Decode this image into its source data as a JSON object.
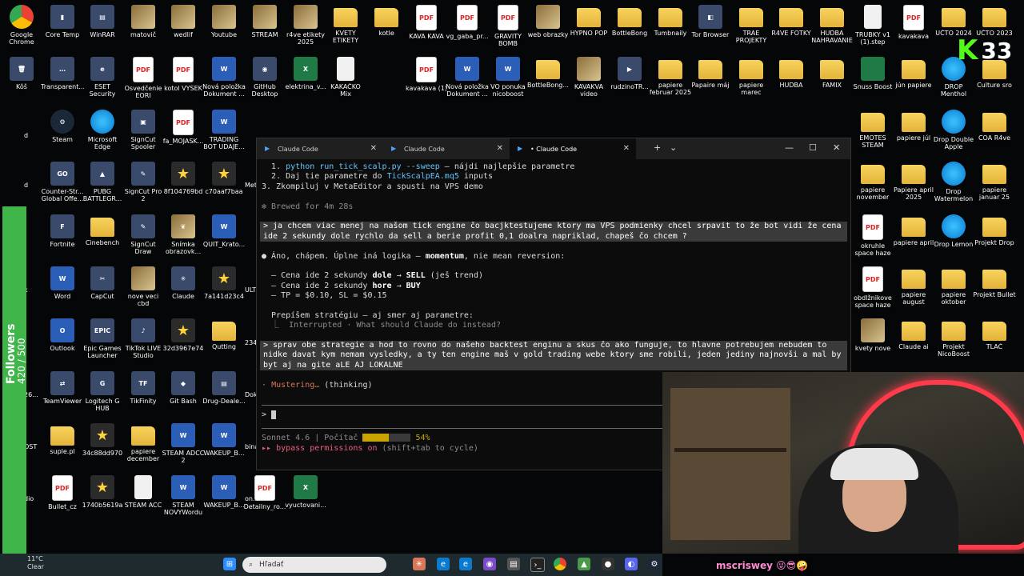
{
  "desktop": {
    "icons": [
      {
        "label": "Google Chrome",
        "kind": "chrome",
        "glyph": ""
      },
      {
        "label": "Core Temp",
        "kind": "app",
        "glyph": "▮"
      },
      {
        "label": "WinRAR",
        "kind": "app",
        "glyph": "▤"
      },
      {
        "label": "matovič",
        "kind": "img",
        "glyph": ""
      },
      {
        "label": "wedlif",
        "kind": "img",
        "glyph": ""
      },
      {
        "label": "Youtube",
        "kind": "img",
        "glyph": ""
      },
      {
        "label": "STREAM",
        "kind": "img",
        "glyph": ""
      },
      {
        "label": "r4ve etikety 2025",
        "kind": "img",
        "glyph": ""
      },
      {
        "label": "KVETY ETIKETY",
        "kind": "folder",
        "glyph": ""
      },
      {
        "label": "kotle",
        "kind": "folder",
        "glyph": ""
      },
      {
        "label": "KAVA KAVA",
        "kind": "pdf",
        "glyph": "PDF"
      },
      {
        "label": "vg_gaba_pr...",
        "kind": "pdf",
        "glyph": "PDF"
      },
      {
        "label": "GRAVITY BOMB",
        "kind": "pdf",
        "glyph": "PDF"
      },
      {
        "label": "web obrazky",
        "kind": "img",
        "glyph": ""
      },
      {
        "label": "HYPNO POP",
        "kind": "folder",
        "glyph": ""
      },
      {
        "label": "BottleBong",
        "kind": "folder",
        "glyph": ""
      },
      {
        "label": "Tumbnaily",
        "kind": "folder",
        "glyph": ""
      },
      {
        "label": "Tor Browser",
        "kind": "app",
        "glyph": "◧"
      },
      {
        "label": "TRAE PROJEKTY",
        "kind": "folder",
        "glyph": ""
      },
      {
        "label": "R4VE FOTKY",
        "kind": "folder",
        "glyph": ""
      },
      {
        "label": "HUDBA NAHRAVANIE",
        "kind": "folder",
        "glyph": ""
      },
      {
        "label": "TRUBKY v1 (1).step",
        "kind": "file",
        "glyph": ""
      },
      {
        "label": "kavakava",
        "kind": "pdf",
        "glyph": "PDF"
      },
      {
        "label": "UČTO 2024",
        "kind": "folder",
        "glyph": ""
      },
      {
        "label": "UČTO 2023",
        "kind": "folder",
        "glyph": ""
      },
      {
        "label": "Kôš",
        "kind": "app",
        "glyph": "🗑"
      },
      {
        "label": "Transparent...",
        "kind": "app",
        "glyph": "…"
      },
      {
        "label": "ESET Security",
        "kind": "app",
        "glyph": "e"
      },
      {
        "label": "Osvedčenie EORI",
        "kind": "pdf",
        "glyph": "PDF"
      },
      {
        "label": "kotol VYSEK",
        "kind": "pdf",
        "glyph": "PDF"
      },
      {
        "label": "Nová položka Dokument ...",
        "kind": "word",
        "glyph": "W"
      },
      {
        "label": "GitHub Desktop",
        "kind": "app",
        "glyph": "◉"
      },
      {
        "label": "elektrina_v...",
        "kind": "excel",
        "glyph": "X"
      },
      {
        "label": "KAKAČKO Mix",
        "kind": "file",
        "glyph": ""
      },
      {
        "label": "kavakava (1)",
        "kind": "pdf",
        "glyph": "PDF"
      },
      {
        "label": "Nová položka Dokument ...",
        "kind": "word",
        "glyph": "W"
      },
      {
        "label": "VO ponuka nicoboost",
        "kind": "word",
        "glyph": "W"
      },
      {
        "label": "BottleBong...",
        "kind": "folder",
        "glyph": ""
      },
      {
        "label": "KAVAKVA video",
        "kind": "img",
        "glyph": ""
      },
      {
        "label": "rudzinoTR...",
        "kind": "app",
        "glyph": "▶"
      },
      {
        "label": "papiere februar 2025",
        "kind": "folder",
        "glyph": ""
      },
      {
        "label": "Papaire máj",
        "kind": "folder",
        "glyph": ""
      },
      {
        "label": "papiere marec",
        "kind": "folder",
        "glyph": ""
      },
      {
        "label": "HUDBA",
        "kind": "folder",
        "glyph": ""
      },
      {
        "label": "FAMIX",
        "kind": "folder",
        "glyph": ""
      },
      {
        "label": "Snuss Boost",
        "kind": "excel",
        "glyph": ""
      },
      {
        "label": "jún papiere",
        "kind": "folder",
        "glyph": ""
      },
      {
        "label": "DROP Menthol",
        "kind": "edge",
        "glyph": ""
      },
      {
        "label": "Culture sro",
        "kind": "folder",
        "glyph": ""
      },
      {
        "label": "Steam",
        "kind": "steam",
        "glyph": "⚙"
      },
      {
        "label": "Microsoft Edge",
        "kind": "edge",
        "glyph": ""
      },
      {
        "label": "SignCut Spooler",
        "kind": "app",
        "glyph": "▣"
      },
      {
        "label": "fa_MOJASK...",
        "kind": "pdf",
        "glyph": "PDF"
      },
      {
        "label": "TRADING BOT UDAJE...",
        "kind": "word",
        "glyph": "W"
      },
      {
        "label": "EMOTES STEAM",
        "kind": "folder",
        "glyph": ""
      },
      {
        "label": "papiere júl",
        "kind": "folder",
        "glyph": ""
      },
      {
        "label": "Drop Double Apple",
        "kind": "edge",
        "glyph": ""
      },
      {
        "label": "COA R4ve",
        "kind": "folder",
        "glyph": ""
      },
      {
        "label": "Counter-Str... Global Offe...",
        "kind": "app",
        "glyph": "GO"
      },
      {
        "label": "PUBG BATTLEGR...",
        "kind": "app",
        "glyph": "▲"
      },
      {
        "label": "SignCut Pro 2",
        "kind": "app",
        "glyph": "✎"
      },
      {
        "label": "8f104769bd",
        "kind": "star",
        "glyph": "★"
      },
      {
        "label": "c70aaf7baa",
        "kind": "star",
        "glyph": "★"
      },
      {
        "label": "papiere november",
        "kind": "folder",
        "glyph": ""
      },
      {
        "label": "Papiere april 2025",
        "kind": "folder",
        "glyph": ""
      },
      {
        "label": "Drop Watermelon",
        "kind": "edge",
        "glyph": ""
      },
      {
        "label": "papiere januar 25",
        "kind": "folder",
        "glyph": ""
      },
      {
        "label": "Fortnite",
        "kind": "app",
        "glyph": "F"
      },
      {
        "label": "Cinebench",
        "kind": "folder",
        "glyph": ""
      },
      {
        "label": "SignCut Draw",
        "kind": "app",
        "glyph": "✎"
      },
      {
        "label": "Snímka obrazovk...",
        "kind": "img",
        "glyph": "❦"
      },
      {
        "label": "QUIT_Krato...",
        "kind": "word",
        "glyph": "W"
      },
      {
        "label": "okruhle space haze",
        "kind": "pdf",
        "glyph": "PDF"
      },
      {
        "label": "papiere april",
        "kind": "folder",
        "glyph": ""
      },
      {
        "label": "Drop Lemon",
        "kind": "edge",
        "glyph": ""
      },
      {
        "label": "Projekt Drop",
        "kind": "folder",
        "glyph": ""
      },
      {
        "label": "Word",
        "kind": "word",
        "glyph": "W"
      },
      {
        "label": "CapCut",
        "kind": "app",
        "glyph": "✂"
      },
      {
        "label": "nove veci cbd",
        "kind": "img",
        "glyph": ""
      },
      {
        "label": "Claude",
        "kind": "app",
        "glyph": "✳"
      },
      {
        "label": "7a141d23c4",
        "kind": "star",
        "glyph": "★"
      },
      {
        "label": "obdlžnikove space haze",
        "kind": "pdf",
        "glyph": "PDF"
      },
      {
        "label": "papiere august",
        "kind": "folder",
        "glyph": ""
      },
      {
        "label": "papiere oktober",
        "kind": "folder",
        "glyph": ""
      },
      {
        "label": "Projekt Bullet",
        "kind": "folder",
        "glyph": ""
      },
      {
        "label": "Outlook",
        "kind": "word",
        "glyph": "O"
      },
      {
        "label": "Epic Games Launcher",
        "kind": "app",
        "glyph": "EPIC"
      },
      {
        "label": "TikTok LIVE Studio",
        "kind": "app",
        "glyph": "♪"
      },
      {
        "label": "32d3967e74",
        "kind": "star",
        "glyph": "★"
      },
      {
        "label": "Qutting",
        "kind": "folder",
        "glyph": ""
      },
      {
        "label": "kvety nove",
        "kind": "img",
        "glyph": ""
      },
      {
        "label": "Claude ai",
        "kind": "folder",
        "glyph": ""
      },
      {
        "label": "Projekt NicoBoost",
        "kind": "folder",
        "glyph": ""
      },
      {
        "label": "TLAČ",
        "kind": "folder",
        "glyph": ""
      },
      {
        "label": "TeamViewer",
        "kind": "app",
        "glyph": "⇄"
      },
      {
        "label": "Logitech G HUB",
        "kind": "app",
        "glyph": "G"
      },
      {
        "label": "TikFinity",
        "kind": "app",
        "glyph": "TF"
      },
      {
        "label": "Git Bash",
        "kind": "app",
        "glyph": "◆"
      },
      {
        "label": "Drug-Deale...",
        "kind": "app",
        "glyph": "▤"
      },
      {
        "label": "suple.pl",
        "kind": "folder",
        "glyph": ""
      },
      {
        "label": "34c88dd970",
        "kind": "star",
        "glyph": "★"
      },
      {
        "label": "papiere december",
        "kind": "folder",
        "glyph": ""
      },
      {
        "label": "STEAM ADCC 2",
        "kind": "word",
        "glyph": "W"
      },
      {
        "label": "WAKEUP_B...",
        "kind": "word",
        "glyph": "W"
      },
      {
        "label": "Bullet_cz",
        "kind": "pdf",
        "glyph": "PDF"
      },
      {
        "label": "1740b5619a",
        "kind": "star",
        "glyph": "★"
      },
      {
        "label": "STEAM ACC",
        "kind": "file",
        "glyph": ""
      },
      {
        "label": "STEAM NOVYWordu",
        "kind": "word",
        "glyph": "W"
      },
      {
        "label": "WAKEUP_B...",
        "kind": "word",
        "glyph": "W"
      },
      {
        "label": "Detailny_ro...",
        "kind": "pdf",
        "glyph": "PDF"
      },
      {
        "label": "vyuctovani...",
        "kind": "excel",
        "glyph": "X"
      }
    ],
    "partial_labels": [
      "Meta",
      "ULT",
      "234",
      "Dok",
      "bina",
      "on...",
      "d",
      "d",
      "k",
      "26...",
      "OST",
      "dio"
    ]
  },
  "terminal": {
    "tabs": [
      {
        "label": "Claude Code",
        "active": false
      },
      {
        "label": "Claude Code",
        "active": false
      },
      {
        "label": "Claude Code",
        "active": true,
        "prefix": "•"
      }
    ],
    "controls": {
      "new_tab": "+",
      "dropdown": "⌄",
      "minimize": "—",
      "maximize": "☐",
      "close": "✕"
    },
    "lines": {
      "l1_num": "1.",
      "l1_cmd": "python run_tick_scalp.py --sweep",
      "l1_rest": " – nájdi najlepšie parametre",
      "l2_num": "2.",
      "l2_a": "Daj tie parametre do ",
      "l2_file": "TickScalpEA.mq5",
      "l2_b": " inputs",
      "l3": "3. Zkompiluj v MetaEditor a spusti na VPS demo",
      "brewed": "✻ Brewed for 4m 28s",
      "user1": "> ja chcem viac menej na našom tick engine čo bacjktestujeme ktory ma VPS podmienky chcel srpavit to že bot vidi že cena ide 2 sekundy dole rychlo da sell a berie profit 0,1 doalra napriklad, chapeš čo chcem ?",
      "ans_bullet": "●",
      "ans_a": " Áno, chápem. Úplne iná logika – ",
      "ans_b": "momentum",
      "ans_c": ", nie mean reversion:",
      "b1_a": "  – Cena ide 2 sekundy ",
      "b1_b": "dole",
      "b1_c": " → ",
      "b1_d": "SELL",
      "b1_e": " (ješ trend)",
      "b2_a": "  – Cena ide 2 sekundy ",
      "b2_b": "hore",
      "b2_c": " → ",
      "b2_d": "BUY",
      "b3": "  – TP = $0.10, SL = $0.15",
      "rewrite": "  Prepíšem stratégiu – aj smer aj parametre:",
      "interrupted": "  ⎿  Interrupted · What should Claude do instead?",
      "user2": "> sprav obe strategie a hod to rovno do našeho backtest enginu a skus čo ako funguje, to hlavne potrebujem nebudem to nidke davat kym nemam vysledky, a ty ten engine maš v gold trading webe ktory sme robili, jeden jediny najnovši a mal by byt aj na gite aLE AJ LOKALNE",
      "status_star": "·",
      "status_word": "Mustering…",
      "status_rest": " (thinking)",
      "prompt": ">",
      "model": "Sonnet 4.6",
      "pipe": " | ",
      "ctx": "Počítač",
      "pct": "54%",
      "bypass_a": "▸▸ ",
      "bypass_b": "bypass permissions on",
      "bypass_c": " (shift+tab to cycle)"
    },
    "context_fill": 0.54
  },
  "overlay": {
    "followers_label": "Followers",
    "followers_count": "420 / 500",
    "kick_logo": "K",
    "kick_viewers": "33",
    "streamer_name": "mscriswey 😜😎🤪"
  },
  "taskbar": {
    "weather_temp": "11°C",
    "weather_desc": "Clear",
    "search_placeholder": "Hľadať",
    "start_icon": "windows-icon"
  },
  "colors": {
    "accent_green": "#53fc18",
    "claude_orange": "#d77757",
    "link_cyan": "#63c4ff",
    "bypass_pink": "#e8607e"
  }
}
